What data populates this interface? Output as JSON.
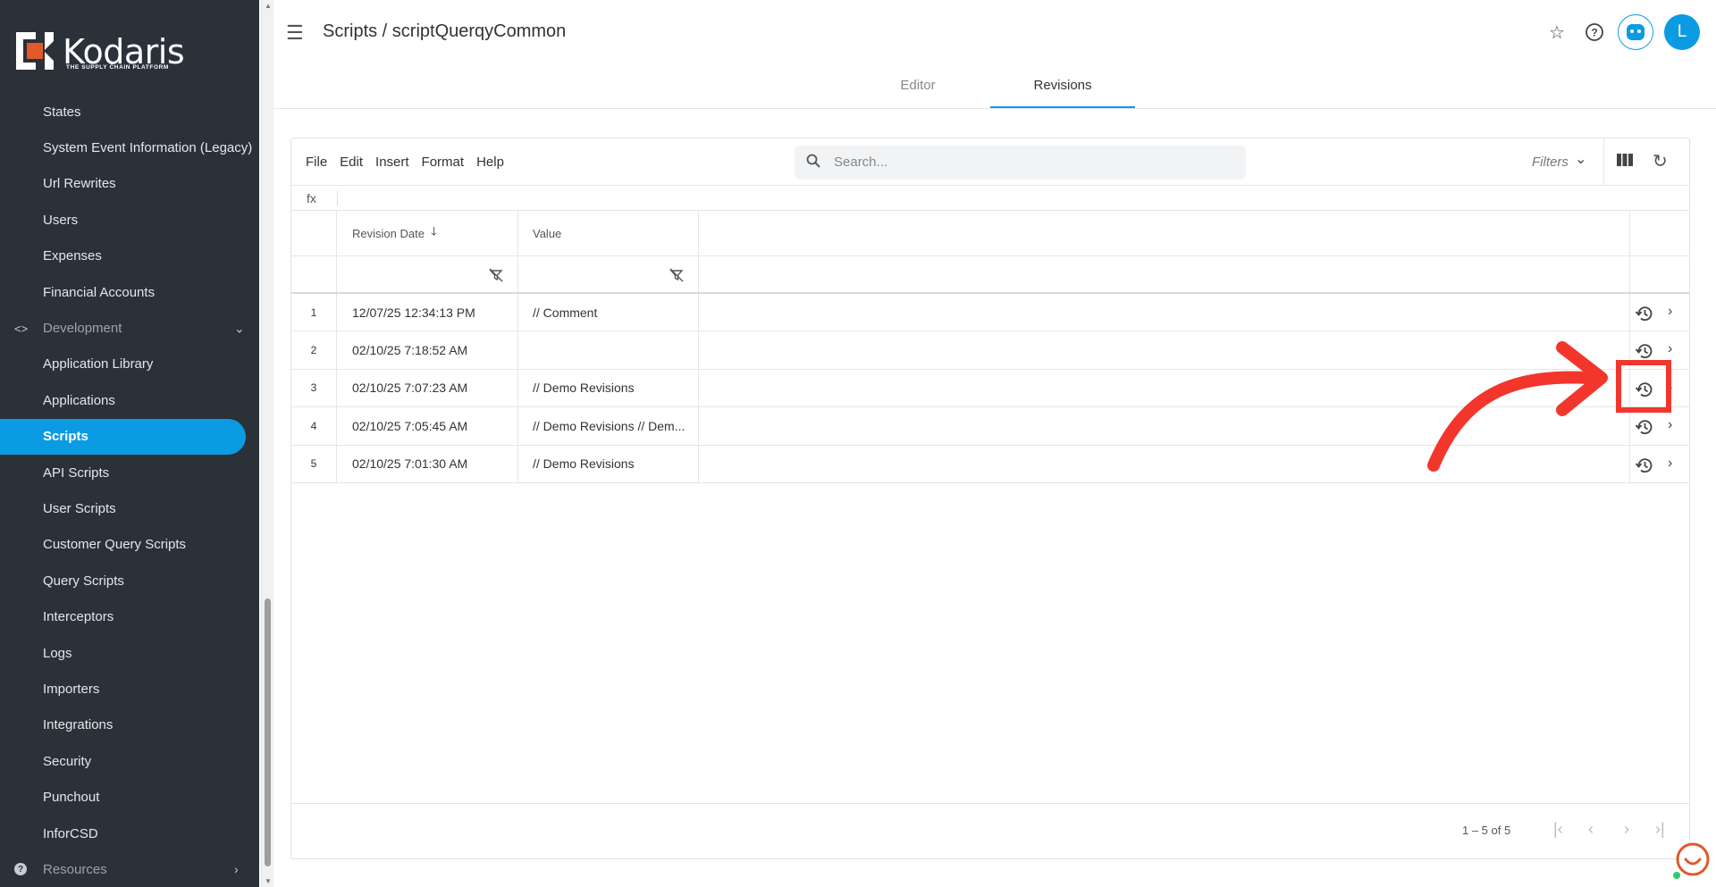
{
  "brand": {
    "name": "Kodaris",
    "tagline": "THE SUPPLY CHAIN PLATFORM"
  },
  "sidebar": {
    "items": [
      {
        "label": "States"
      },
      {
        "label": "System Event Information (Legacy)"
      },
      {
        "label": "Url Rewrites"
      },
      {
        "label": "Users"
      },
      {
        "label": "Expenses"
      },
      {
        "label": "Financial Accounts"
      },
      {
        "label": "Development",
        "icon": "code-icon",
        "group": true
      },
      {
        "label": "Application Library"
      },
      {
        "label": "Applications"
      },
      {
        "label": "Scripts",
        "active": true
      },
      {
        "label": "API Scripts"
      },
      {
        "label": "User Scripts"
      },
      {
        "label": "Customer Query Scripts"
      },
      {
        "label": "Query Scripts"
      },
      {
        "label": "Interceptors"
      },
      {
        "label": "Logs"
      },
      {
        "label": "Importers"
      },
      {
        "label": "Integrations"
      },
      {
        "label": "Security"
      },
      {
        "label": "Punchout"
      },
      {
        "label": "InforCSD"
      },
      {
        "label": "Resources",
        "icon": "help-circle-icon",
        "group": true
      }
    ]
  },
  "header": {
    "breadcrumb": "Scripts / scriptQuerqyCommon",
    "avatar_initial": "L",
    "tabs": [
      {
        "label": "Editor",
        "active": false
      },
      {
        "label": "Revisions",
        "active": true
      }
    ]
  },
  "toolbar": {
    "menu": [
      "File",
      "Edit",
      "Insert",
      "Format",
      "Help"
    ],
    "search_placeholder": "Search...",
    "filters_label": "Filters",
    "fx_label": "fx"
  },
  "grid": {
    "columns": [
      "Revision Date",
      "Value"
    ],
    "rows": [
      {
        "num": "1",
        "date": "12/07/25 12:34:13 PM",
        "value": "// Comment"
      },
      {
        "num": "2",
        "date": "02/10/25 7:18:52 AM",
        "value": ""
      },
      {
        "num": "3",
        "date": "02/10/25 7:07:23 AM",
        "value": "// Demo Revisions"
      },
      {
        "num": "4",
        "date": "02/10/25 7:05:45 AM",
        "value": "// Demo Revisions // Dem..."
      },
      {
        "num": "5",
        "date": "02/10/25 7:01:30 AM",
        "value": "// Demo Revisions"
      }
    ],
    "pagination": "1 – 5 of 5"
  },
  "colors": {
    "accent": "#0b9be3",
    "sidebar_bg": "#2b3139",
    "annotation": "#f3362c"
  }
}
